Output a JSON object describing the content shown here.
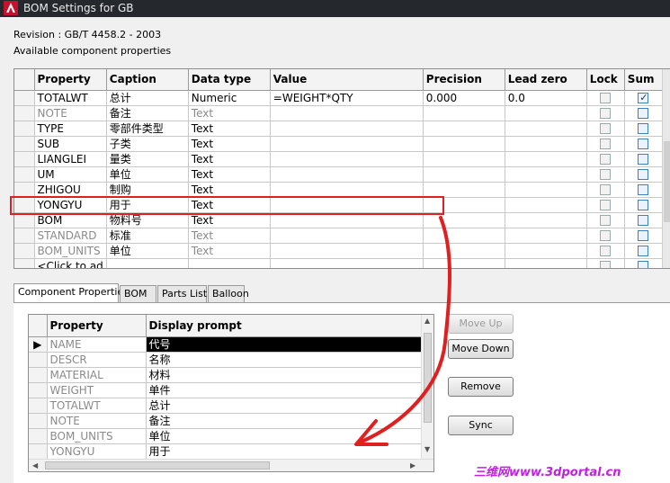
{
  "window": {
    "title": "BOM Settings for GB",
    "icon": "autocad-a-icon"
  },
  "revision_text": "Revision : GB/T 4458.2 - 2003",
  "available_label": "Available component properties",
  "top_grid": {
    "columns": [
      "Property",
      "Caption",
      "Data type",
      "Value",
      "Precision",
      "Lead zero",
      "Lock",
      "Sum"
    ],
    "rows": [
      {
        "property": "TOTALWT",
        "caption": "总计",
        "type": "Numeric",
        "value": "=WEIGHT*QTY",
        "precision": "0.000",
        "lead": "0.0",
        "grey": false,
        "lock": false,
        "sum": true
      },
      {
        "property": "NOTE",
        "caption": "备注",
        "type": "Text",
        "value": "",
        "precision": "",
        "lead": "",
        "grey": true,
        "lock": false,
        "sum": false
      },
      {
        "property": "TYPE",
        "caption": "零部件类型",
        "type": "Text",
        "value": "",
        "precision": "",
        "lead": "",
        "grey": false,
        "lock": false,
        "sum": false
      },
      {
        "property": "SUB",
        "caption": "子类",
        "type": "Text",
        "value": "",
        "precision": "",
        "lead": "",
        "grey": false,
        "lock": false,
        "sum": false
      },
      {
        "property": "LIANGLEI",
        "caption": "量类",
        "type": "Text",
        "value": "",
        "precision": "",
        "lead": "",
        "grey": false,
        "lock": false,
        "sum": false
      },
      {
        "property": "UM",
        "caption": "单位",
        "type": "Text",
        "value": "",
        "precision": "",
        "lead": "",
        "grey": false,
        "lock": false,
        "sum": false
      },
      {
        "property": "ZHIGOU",
        "caption": "制购",
        "type": "Text",
        "value": "",
        "precision": "",
        "lead": "",
        "grey": false,
        "lock": false,
        "sum": false
      },
      {
        "property": "YONGYU",
        "caption": "用于",
        "type": "Text",
        "value": "",
        "precision": "",
        "lead": "",
        "grey": false,
        "lock": false,
        "sum": false
      },
      {
        "property": "BOM",
        "caption": "物料号",
        "type": "Text",
        "value": "",
        "precision": "",
        "lead": "",
        "grey": false,
        "lock": false,
        "sum": false
      },
      {
        "property": "STANDARD",
        "caption": "标准",
        "type": "Text",
        "value": "",
        "precision": "",
        "lead": "",
        "grey": true,
        "lock": false,
        "sum": false
      },
      {
        "property": "BOM_UNITS",
        "caption": "单位",
        "type": "Text",
        "value": "",
        "precision": "",
        "lead": "",
        "grey": true,
        "lock": false,
        "sum": false
      },
      {
        "property": "<Click to ad",
        "caption": "",
        "type": "",
        "value": "",
        "precision": "",
        "lead": "",
        "grey": false,
        "lock": false,
        "sum": false
      }
    ]
  },
  "tabs": [
    "Component Properties",
    "BOM",
    "Parts List",
    "Balloon"
  ],
  "active_tab": 0,
  "bottom_grid": {
    "columns": [
      "Property",
      "Display prompt"
    ],
    "rows": [
      {
        "property": "NAME",
        "prompt": "代号"
      },
      {
        "property": "DESCR",
        "prompt": "名称"
      },
      {
        "property": "MATERIAL",
        "prompt": "材料"
      },
      {
        "property": "WEIGHT",
        "prompt": "单件"
      },
      {
        "property": "TOTALWT",
        "prompt": "总计"
      },
      {
        "property": "NOTE",
        "prompt": "备注"
      },
      {
        "property": "BOM_UNITS",
        "prompt": "单位"
      },
      {
        "property": "YONGYU",
        "prompt": "用于"
      }
    ]
  },
  "buttons": {
    "move_up": "Move Up",
    "move_down": "Move Down",
    "remove": "Remove",
    "sync": "Sync"
  },
  "watermark": "三维网www.3dportal.cn",
  "colors": {
    "highlight": "#e02020",
    "title_bar": "#25292d",
    "watermark": "#c020e0"
  }
}
